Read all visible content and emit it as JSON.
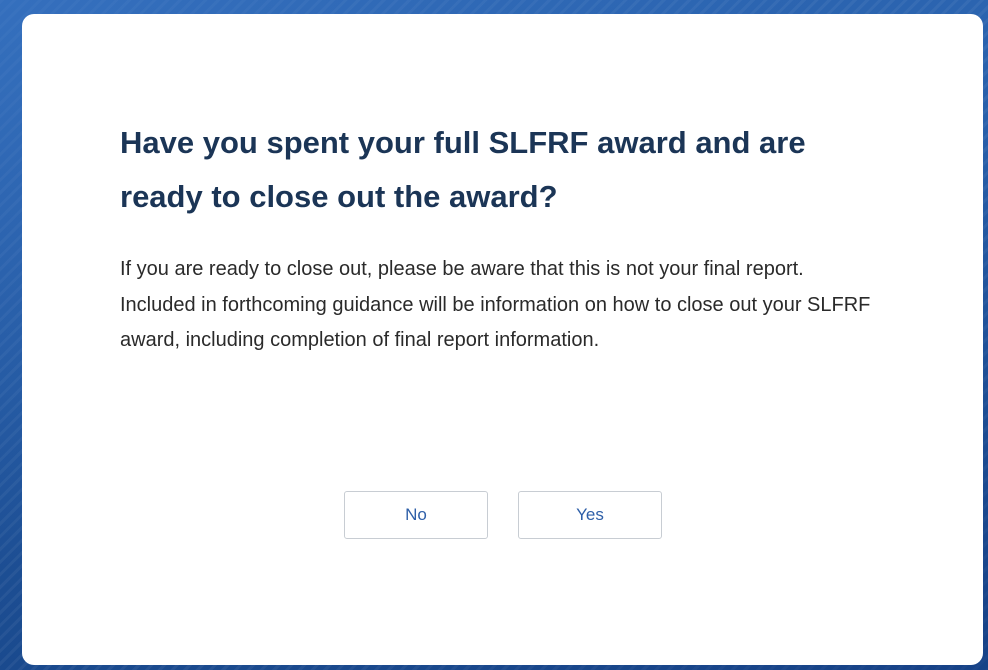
{
  "dialog": {
    "title": "Have you spent your full SLFRF award and are ready to close out the award?",
    "body": "If you are ready to close out, please be aware that this is not your final report. Included in forthcoming guidance will be information on how to close out your SLFRF award, including completion of final report information.",
    "buttons": {
      "no_label": "No",
      "yes_label": "Yes"
    }
  },
  "colors": {
    "title": "#1b3556",
    "body_text": "#2a2a2a",
    "button_text": "#2e5fa8",
    "button_border": "#c8cdd3",
    "backdrop": "#1a4e96"
  }
}
